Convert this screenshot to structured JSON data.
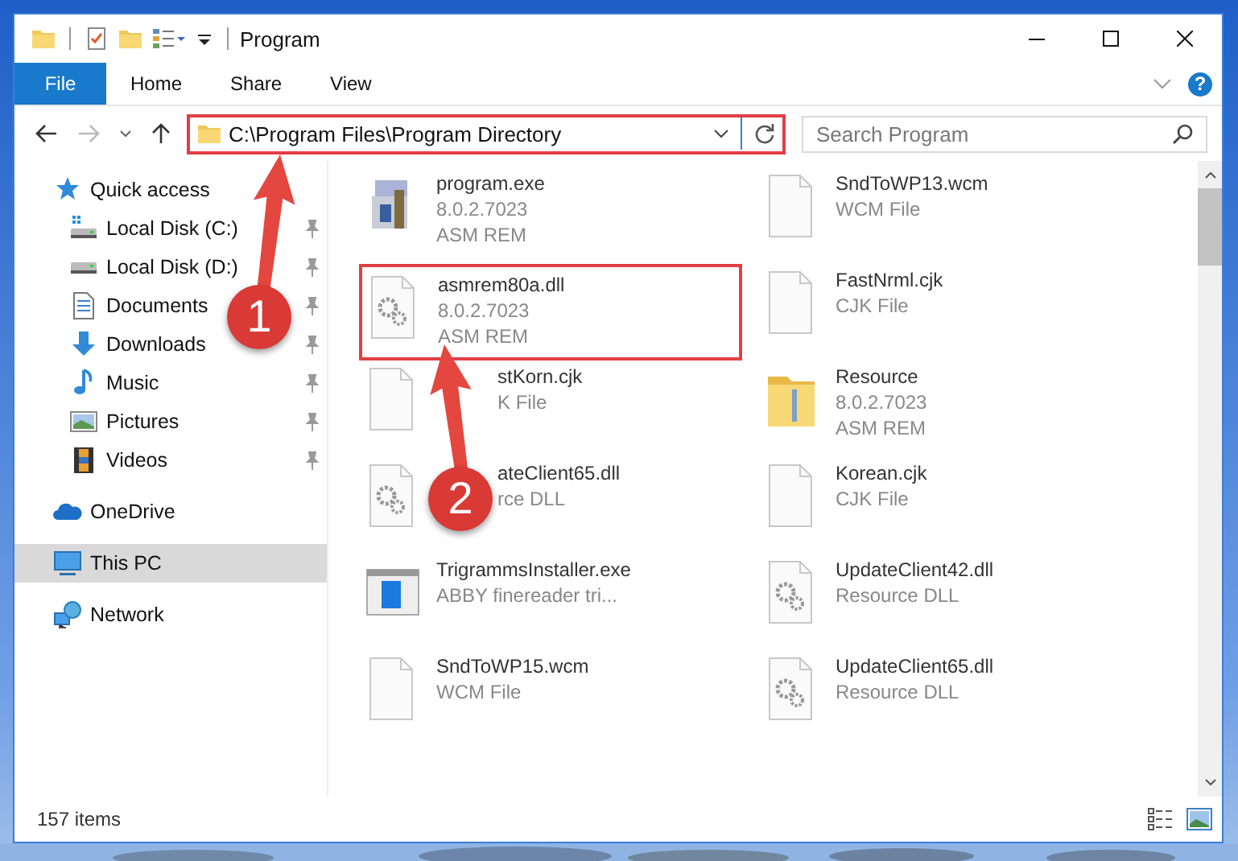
{
  "window": {
    "title": "Program"
  },
  "ribbon": {
    "file_tab": "File",
    "tabs": [
      {
        "label": "Home",
        "selected": false
      },
      {
        "label": "Share",
        "selected": false
      },
      {
        "label": "View",
        "selected": false
      }
    ],
    "help": "?"
  },
  "address_bar": {
    "path": "C:\\Program Files\\Program Directory",
    "highlighted": true
  },
  "search": {
    "placeholder": "Search Program"
  },
  "sidebar": {
    "items": [
      {
        "label": "Quick access",
        "selected": false,
        "children": [
          {
            "label": "Local Disk (C:)",
            "pinned": true,
            "selected": false
          },
          {
            "label": "Local Disk (D:)",
            "pinned": true,
            "selected": false
          },
          {
            "label": "Documents",
            "pinned": true,
            "selected": false
          },
          {
            "label": "Downloads",
            "pinned": true,
            "selected": false
          },
          {
            "label": "Music",
            "pinned": true,
            "selected": false
          },
          {
            "label": "Pictures",
            "pinned": true,
            "selected": false
          },
          {
            "label": "Videos",
            "pinned": true,
            "selected": false
          }
        ]
      },
      {
        "label": "OneDrive",
        "selected": false
      },
      {
        "label": "This PC",
        "selected": true
      },
      {
        "label": "Network",
        "selected": false
      }
    ]
  },
  "files": [
    {
      "name": "program.exe",
      "details": [
        "8.0.2.7023",
        "ASM REM"
      ],
      "kind": "app",
      "highlighted": false,
      "partly_hidden": false
    },
    {
      "name": "SndToWP13.wcm",
      "details": [
        "WCM File"
      ],
      "kind": "blank",
      "highlighted": false,
      "partly_hidden": false
    },
    {
      "name": "asmrem80a.dll",
      "details": [
        "8.0.2.7023",
        "ASM REM"
      ],
      "kind": "dll",
      "highlighted": true,
      "partly_hidden": false
    },
    {
      "name": "FastNrml.cjk",
      "details": [
        "CJK File"
      ],
      "kind": "blank",
      "highlighted": false,
      "partly_hidden": false
    },
    {
      "name": "stKorn.cjk",
      "details": [
        "K File"
      ],
      "kind": "blank",
      "highlighted": false,
      "partly_hidden": true
    },
    {
      "name": "Resource",
      "details": [
        "8.0.2.7023",
        "ASM REM"
      ],
      "kind": "folder",
      "highlighted": false,
      "partly_hidden": false
    },
    {
      "name": "ateClient65.dll",
      "details": [
        "rce DLL"
      ],
      "kind": "dll",
      "highlighted": false,
      "partly_hidden": true
    },
    {
      "name": "Korean.cjk",
      "details": [
        "CJK File"
      ],
      "kind": "blank",
      "highlighted": false,
      "partly_hidden": false
    },
    {
      "name": "TrigrammsInstaller.exe",
      "details": [
        "ABBY finereader tri..."
      ],
      "kind": "installer",
      "highlighted": false,
      "partly_hidden": false
    },
    {
      "name": "UpdateClient42.dll",
      "details": [
        "Resource DLL"
      ],
      "kind": "dll",
      "highlighted": false,
      "partly_hidden": false
    },
    {
      "name": "SndToWP15.wcm",
      "details": [
        "WCM File"
      ],
      "kind": "blank",
      "highlighted": false,
      "partly_hidden": false
    },
    {
      "name": "UpdateClient65.dll",
      "details": [
        "Resource DLL"
      ],
      "kind": "dll",
      "highlighted": false,
      "partly_hidden": false
    }
  ],
  "status_bar": {
    "item_count": "157 items"
  },
  "callouts": [
    {
      "label": "1"
    },
    {
      "label": "2"
    }
  ]
}
